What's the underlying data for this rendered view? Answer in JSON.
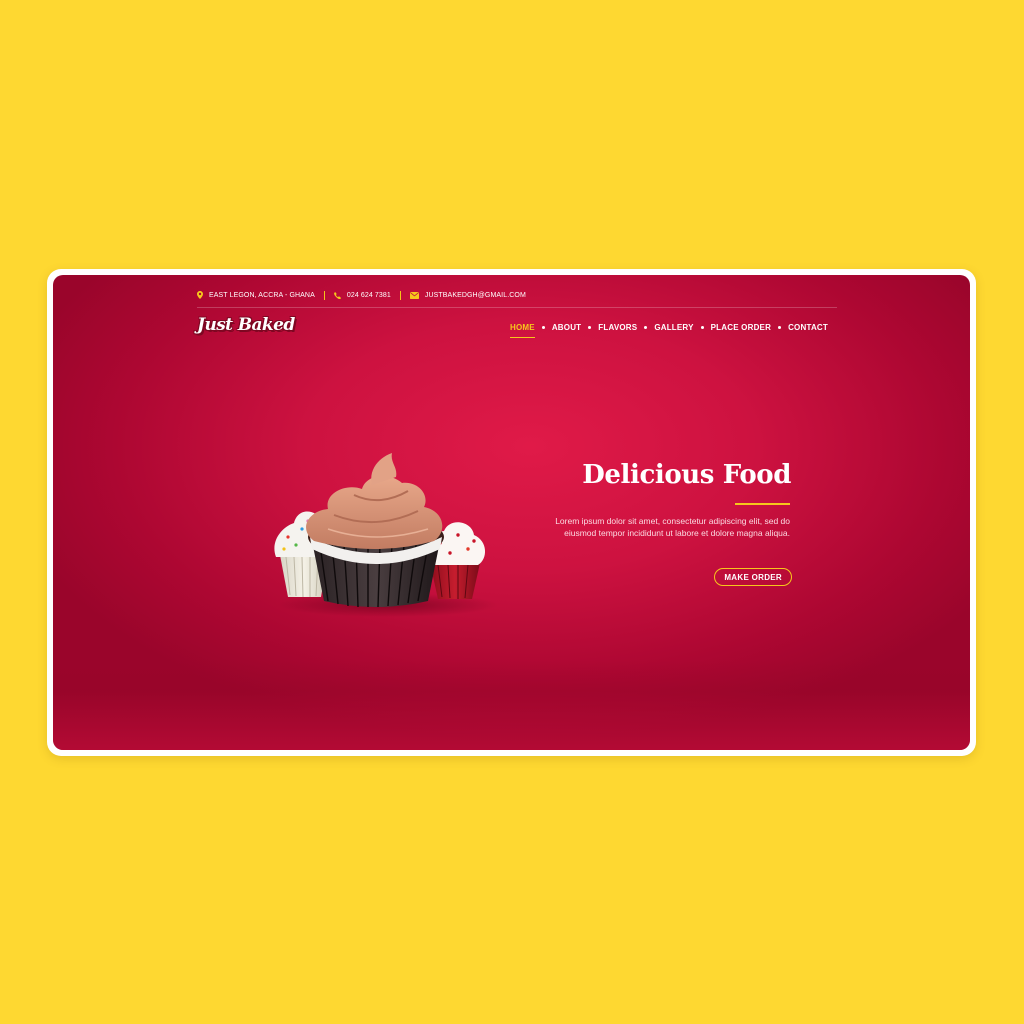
{
  "topbar": {
    "location": "EAST LEGON, ACCRA - GHANA",
    "phone": "024 624 7381",
    "email": "JUSTBAKEDGH@GMAIL.COM"
  },
  "logo": {
    "text": "Just Baked"
  },
  "nav": {
    "items": [
      {
        "label": "HOME",
        "active": true
      },
      {
        "label": "ABOUT"
      },
      {
        "label": "FLAVORS"
      },
      {
        "label": "GALLERY"
      },
      {
        "label": "PLACE ORDER"
      },
      {
        "label": "CONTACT"
      }
    ]
  },
  "hero": {
    "title": "Delicious Food",
    "body": "Lorem ipsum dolor sit amet, consectetur adipiscing elit, sed do eiusmod tempor incididunt ut labore et dolore magna aliqua.",
    "button_label": "MAKE ORDER"
  },
  "colors": {
    "outer_background": "#fed831",
    "hero_red": "#cd1240",
    "accent_yellow": "#f6c71c"
  },
  "icons": {
    "location": "map-pin-icon",
    "phone": "phone-icon",
    "email": "envelope-icon"
  }
}
